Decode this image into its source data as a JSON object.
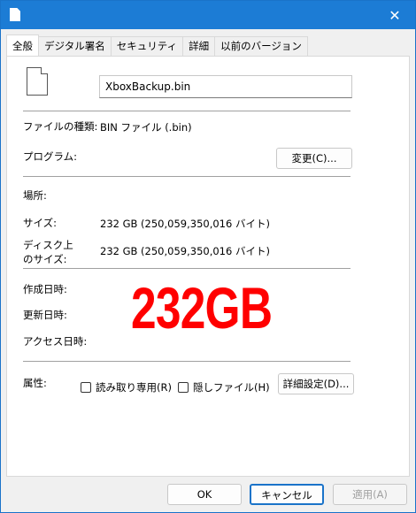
{
  "window": {
    "close_glyph": "✕"
  },
  "tabs": [
    "全般",
    "デジタル署名",
    "セキュリティ",
    "詳細",
    "以前のバージョン"
  ],
  "file": {
    "name": "XboxBackup.bin"
  },
  "fields": {
    "type_label": "ファイルの種類:",
    "type_value": "BIN ファイル (.bin)",
    "program_label": "プログラム:",
    "change_button": "変更(C)...",
    "location_label": "場所:",
    "size_label": "サイズ:",
    "size_value": "232 GB (250,059,350,016 バイト)",
    "disk_label_1": "ディスク上",
    "disk_label_2": "のサイズ:",
    "disk_value": "232 GB (250,059,350,016 バイト)",
    "created_label": "作成日時:",
    "modified_label": "更新日時:",
    "accessed_label": "アクセス日時:",
    "overlay_text": "232GB",
    "attributes_label": "属性:",
    "readonly_label": "読み取り専用(R)",
    "hidden_label": "隠しファイル(H)",
    "advanced_button": "詳細設定(D)..."
  },
  "buttons": {
    "ok": "OK",
    "cancel": "キャンセル",
    "apply": "適用(A)"
  }
}
